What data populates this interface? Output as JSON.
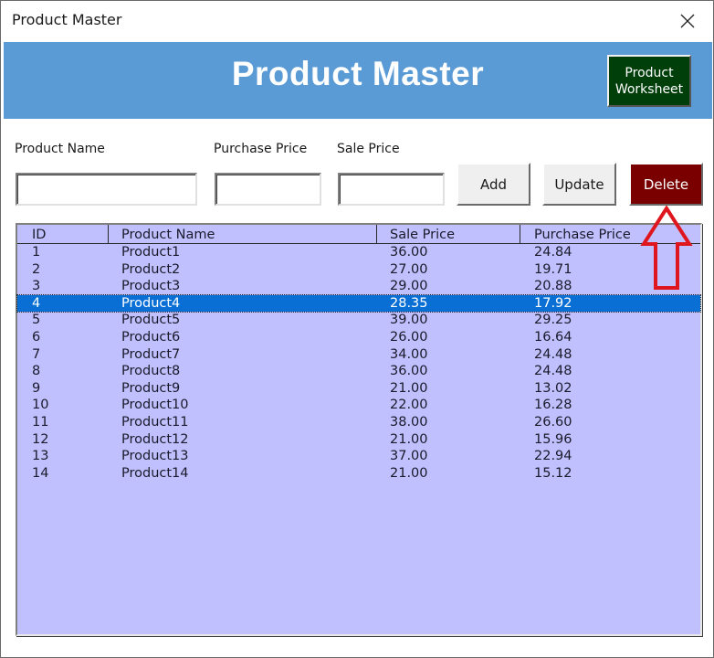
{
  "window": {
    "title": "Product Master",
    "close_icon": "close-icon"
  },
  "banner": {
    "heading": "Product Master",
    "background": "#5b9bd5",
    "worksheet_button": {
      "line1": "Product",
      "line2": "Worksheet",
      "color": "#003f0a"
    }
  },
  "form": {
    "product_name": {
      "label": "Product Name",
      "value": "",
      "placeholder": ""
    },
    "purchase_price": {
      "label": "Purchase Price",
      "value": "",
      "placeholder": ""
    },
    "sale_price": {
      "label": "Sale Price",
      "value": "",
      "placeholder": ""
    },
    "buttons": {
      "add": "Add",
      "update": "Update",
      "delete": "Delete"
    },
    "delete_color": "#7a0000"
  },
  "annotation": {
    "icon": "up-arrow-icon",
    "color": "#e0161e",
    "points_to": "Delete"
  },
  "list": {
    "background": "#c0c0ff",
    "selected_color": "#0a6fd4",
    "columns": [
      "ID",
      "Product Name",
      "Sale Price",
      "Purchase Price"
    ],
    "selected_index": 3,
    "rows": [
      {
        "id": "1",
        "name": "Product1",
        "sale": "36.00",
        "purchase": "24.84"
      },
      {
        "id": "2",
        "name": "Product2",
        "sale": "27.00",
        "purchase": "19.71"
      },
      {
        "id": "3",
        "name": "Product3",
        "sale": "29.00",
        "purchase": "20.88"
      },
      {
        "id": "4",
        "name": "Product4",
        "sale": "28.35",
        "purchase": "17.92"
      },
      {
        "id": "5",
        "name": "Product5",
        "sale": "39.00",
        "purchase": "29.25"
      },
      {
        "id": "6",
        "name": "Product6",
        "sale": "26.00",
        "purchase": "16.64"
      },
      {
        "id": "7",
        "name": "Product7",
        "sale": "34.00",
        "purchase": "24.48"
      },
      {
        "id": "8",
        "name": "Product8",
        "sale": "36.00",
        "purchase": "24.48"
      },
      {
        "id": "9",
        "name": "Product9",
        "sale": "21.00",
        "purchase": "13.02"
      },
      {
        "id": "10",
        "name": "Product10",
        "sale": "22.00",
        "purchase": "16.28"
      },
      {
        "id": "11",
        "name": "Product11",
        "sale": "38.00",
        "purchase": "26.60"
      },
      {
        "id": "12",
        "name": "Product12",
        "sale": "21.00",
        "purchase": "15.96"
      },
      {
        "id": "13",
        "name": "Product13",
        "sale": "37.00",
        "purchase": "22.94"
      },
      {
        "id": "14",
        "name": "Product14",
        "sale": "21.00",
        "purchase": "15.12"
      }
    ]
  }
}
